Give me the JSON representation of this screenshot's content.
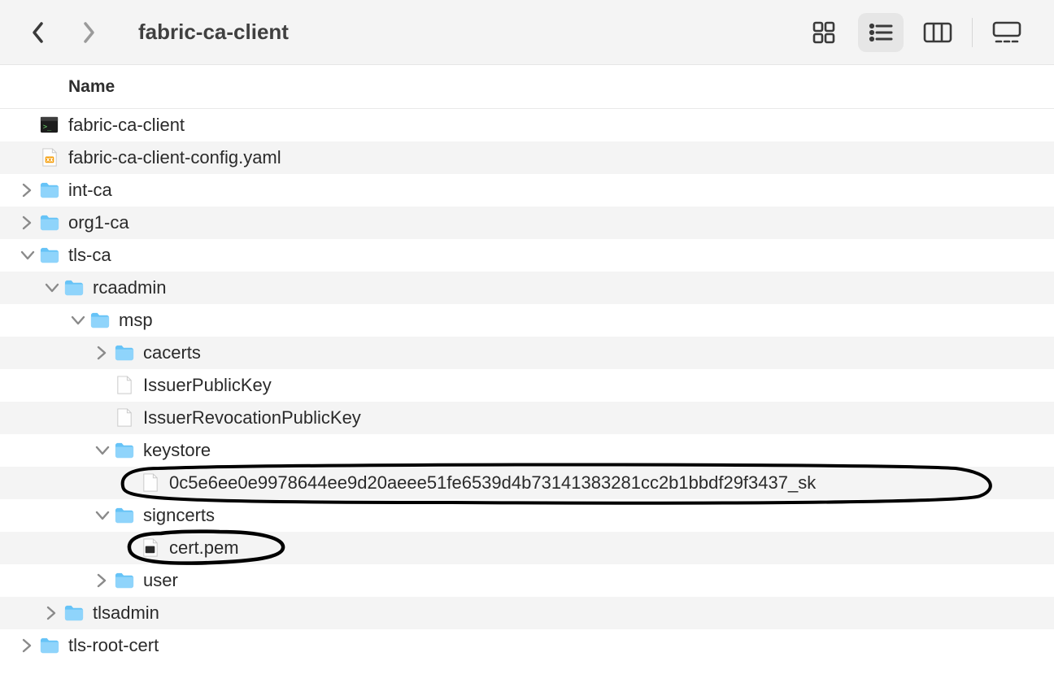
{
  "toolbar": {
    "title": "fabric-ca-client"
  },
  "columns": {
    "name": "Name"
  },
  "rows": [
    {
      "label": "fabric-ca-client",
      "icon": "exec",
      "depth": 0,
      "disclosure": null,
      "alt": false
    },
    {
      "label": "fabric-ca-client-config.yaml",
      "icon": "yaml",
      "depth": 0,
      "disclosure": null,
      "alt": true
    },
    {
      "label": "int-ca",
      "icon": "folder",
      "depth": 0,
      "disclosure": "right",
      "alt": false
    },
    {
      "label": "org1-ca",
      "icon": "folder",
      "depth": 0,
      "disclosure": "right",
      "alt": true
    },
    {
      "label": "tls-ca",
      "icon": "folder",
      "depth": 0,
      "disclosure": "down",
      "alt": false
    },
    {
      "label": "rcaadmin",
      "icon": "folder",
      "depth": 1,
      "disclosure": "down",
      "alt": true
    },
    {
      "label": "msp",
      "icon": "folder",
      "depth": 2,
      "disclosure": "down",
      "alt": false
    },
    {
      "label": "cacerts",
      "icon": "folder",
      "depth": 3,
      "disclosure": "right",
      "alt": true
    },
    {
      "label": "IssuerPublicKey",
      "icon": "file",
      "depth": 3,
      "disclosure": null,
      "alt": false
    },
    {
      "label": "IssuerRevocationPublicKey",
      "icon": "file",
      "depth": 3,
      "disclosure": null,
      "alt": true
    },
    {
      "label": "keystore",
      "icon": "folder",
      "depth": 3,
      "disclosure": "down",
      "alt": false
    },
    {
      "label": "0c5e6ee0e9978644ee9d20aeee51fe6539d4b73141383281cc2b1bbdf29f3437_sk",
      "icon": "file",
      "depth": 4,
      "disclosure": null,
      "alt": true,
      "annot": "big"
    },
    {
      "label": "signcerts",
      "icon": "folder",
      "depth": 3,
      "disclosure": "down",
      "alt": false
    },
    {
      "label": "cert.pem",
      "icon": "badge",
      "depth": 4,
      "disclosure": null,
      "alt": true,
      "annot": "small"
    },
    {
      "label": "user",
      "icon": "folder",
      "depth": 3,
      "disclosure": "right",
      "alt": false
    },
    {
      "label": "tlsadmin",
      "icon": "folder",
      "depth": 1,
      "disclosure": "right",
      "alt": true
    },
    {
      "label": "tls-root-cert",
      "icon": "folder",
      "depth": 0,
      "disclosure": "right",
      "alt": false
    }
  ]
}
